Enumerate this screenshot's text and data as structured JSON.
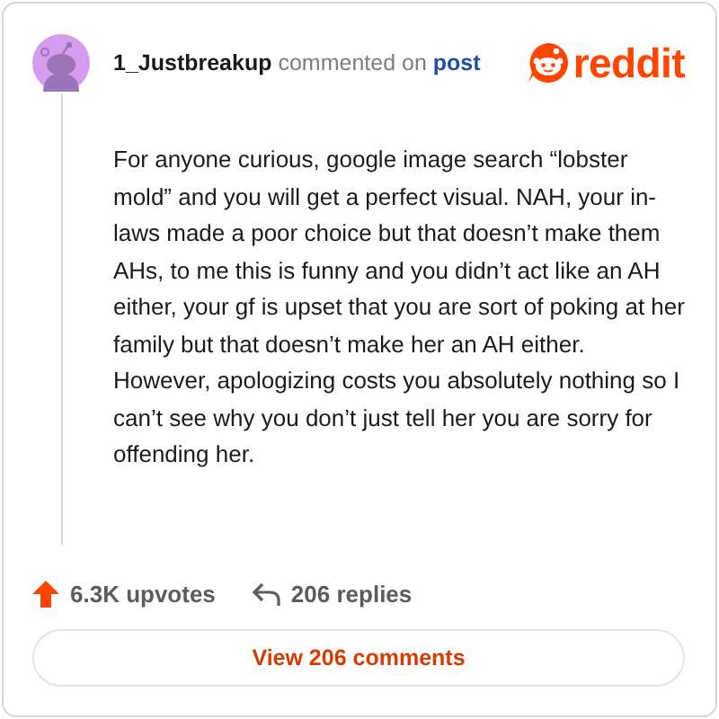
{
  "header": {
    "username": "1_Justbreakup",
    "action": "commented on",
    "target": "post",
    "logo_text": "reddit"
  },
  "comment": {
    "body": "For anyone curious, google image search “lobster mold” and you will get a perfect visual. NAH, your in-laws made a poor choice but that doesn’t make them AHs, to me this is funny and you didn’t act like an AH either, your gf is upset that you are sort of poking at her family but that doesn’t make her an AH either. However, apologizing costs you absolutely nothing so I can’t see why you don’t just tell her you are sorry for offending her."
  },
  "stats": {
    "upvotes": "6.3K upvotes",
    "replies": "206 replies"
  },
  "button": "View 206 comments"
}
